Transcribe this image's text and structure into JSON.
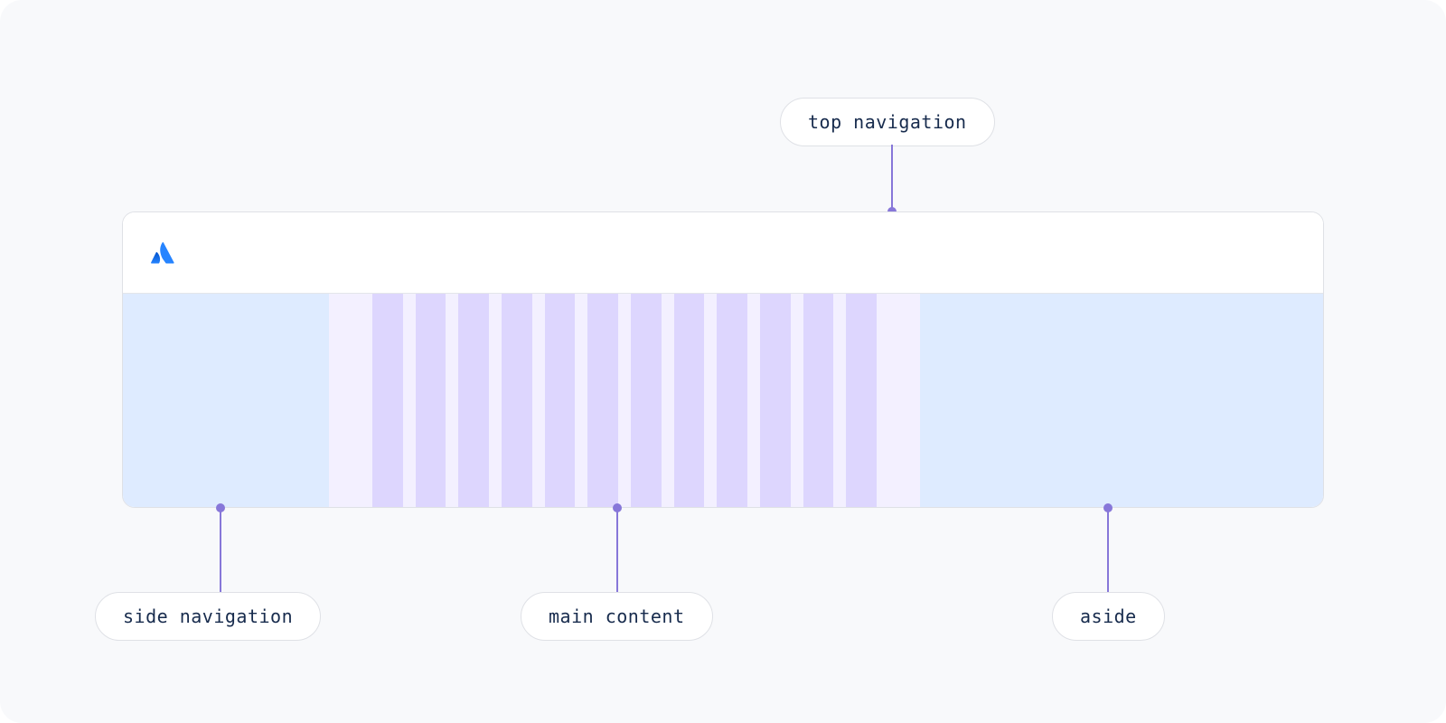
{
  "labels": {
    "top_navigation": "top navigation",
    "side_navigation": "side navigation",
    "main_content": "main content",
    "aside": "aside"
  },
  "icons": {
    "brand": "atlassian"
  },
  "colors": {
    "canvas_bg": "#f8f9fb",
    "window_border": "#dfe1e6",
    "side_bg": "#deebff",
    "aside_bg": "#deebff",
    "main_bg": "#f3f0ff",
    "column_bg": "#ddd6fe",
    "connector": "#8777d9",
    "text": "#172b4d",
    "brand_blue": "#0052cc"
  },
  "main_columns": 12
}
